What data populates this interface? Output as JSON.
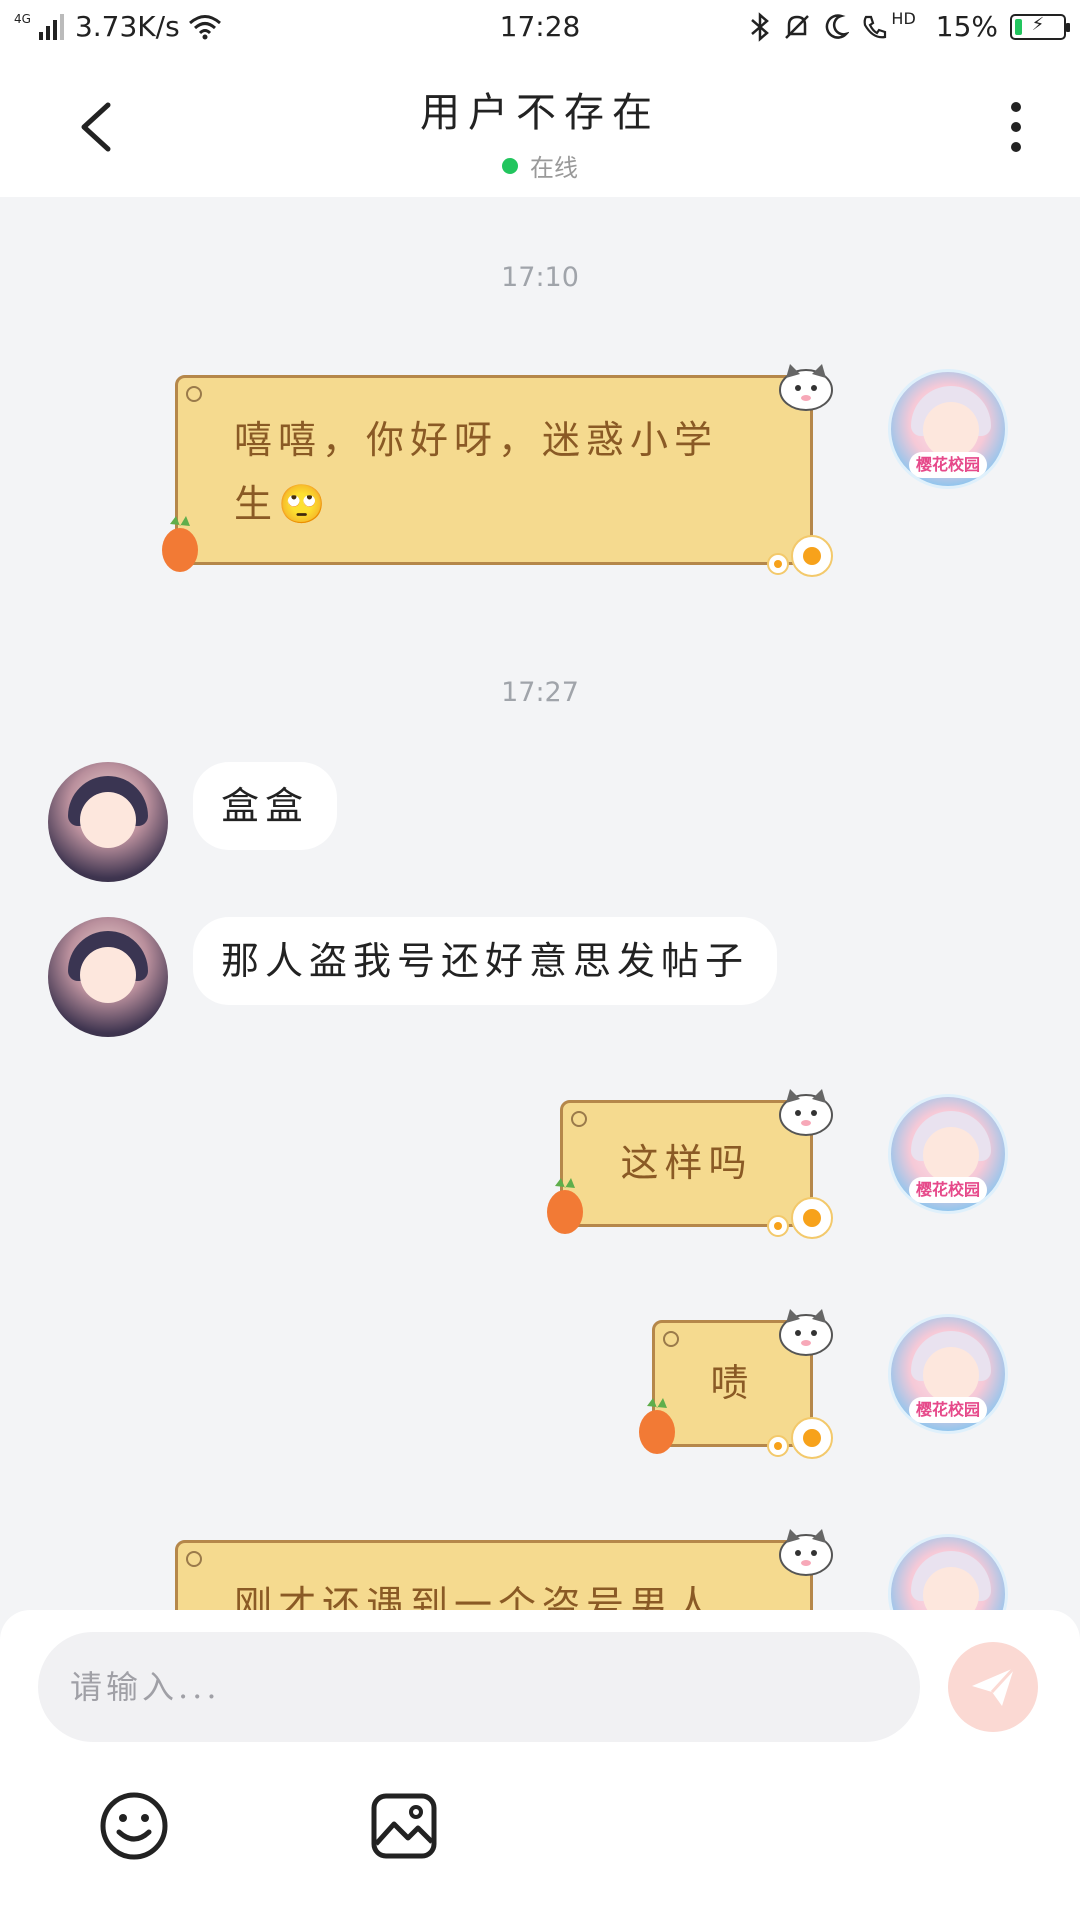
{
  "status_bar": {
    "network": "4G",
    "speed": "3.73K/s",
    "time": "17:28",
    "hd_label": "HD",
    "battery": "15%",
    "battery_level": 0.15
  },
  "header": {
    "title": "用户不存在",
    "status": "在线"
  },
  "chat": {
    "timestamps": [
      "17:10",
      "17:27"
    ],
    "messages": [
      {
        "side": "self",
        "text": "嘻嘻，你好呀，迷惑小学生🙄"
      },
      {
        "side": "other",
        "text": "盒盒"
      },
      {
        "side": "other",
        "text": "那人盗我号还好意思发帖子"
      },
      {
        "side": "self",
        "text": "这样吗"
      },
      {
        "side": "self",
        "text": "啧"
      },
      {
        "side": "self",
        "text": "刚才还遇到一个盗号男人"
      }
    ],
    "self_avatar_badge": "樱花校园"
  },
  "composer": {
    "placeholder": "请输入...",
    "icons": [
      "emoji-icon",
      "image-icon",
      "send-icon"
    ]
  },
  "colors": {
    "self_bubble": "#f5da8f",
    "self_text": "#8a5a25",
    "online": "#22c55e",
    "send": "#fbd9d3"
  }
}
